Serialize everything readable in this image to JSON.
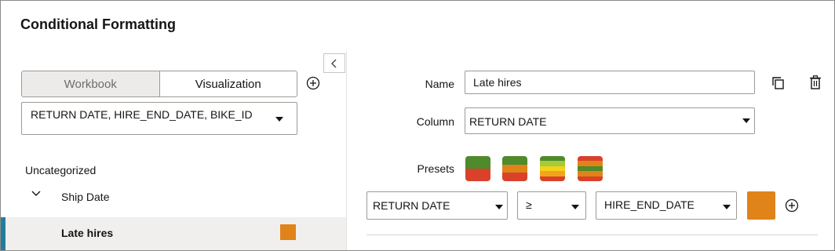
{
  "dialog": {
    "title": "Conditional Formatting"
  },
  "left": {
    "scope_tabs": [
      {
        "label": "Workbook",
        "active": false
      },
      {
        "label": "Visualization",
        "active": true
      }
    ],
    "columns_select": {
      "value": "RETURN DATE, HIRE_END_DATE, BIKE_ID"
    },
    "group_label": "Uncategorized",
    "rules": [
      {
        "label": "Ship Date",
        "selected": false
      },
      {
        "label": "Late hires",
        "selected": true,
        "color": "#E08318"
      }
    ]
  },
  "right": {
    "name_label": "Name",
    "name_value": "Late hires",
    "column_label": "Column",
    "column_value": "RETURN DATE",
    "presets_label": "Presets",
    "presets": [
      {
        "name": "two-band-green-red",
        "colors": [
          "#4f8a2b",
          "#d9412b"
        ]
      },
      {
        "name": "three-band-green-orange-red",
        "colors": [
          "#4f8a2b",
          "#e08318",
          "#d9412b"
        ]
      },
      {
        "name": "five-band-green-yellow-red",
        "colors": [
          "#4f8a2b",
          "#a8c93a",
          "#f2d21b",
          "#f2a51b",
          "#d9412b"
        ]
      },
      {
        "name": "five-band-red-green-mix",
        "colors": [
          "#d9412b",
          "#e08318",
          "#4f8a2b",
          "#e08318",
          "#d9412b"
        ]
      }
    ],
    "condition": {
      "left_operand": "RETURN DATE",
      "operator": "≥",
      "right_operand": "HIRE_END_DATE",
      "format_color": "#E08318"
    }
  },
  "icons": {
    "collapse": "chevron-left-icon",
    "add": "plus-circle-icon",
    "duplicate": "copy-icon",
    "delete": "trash-icon",
    "expand": "chevron-down-icon"
  }
}
